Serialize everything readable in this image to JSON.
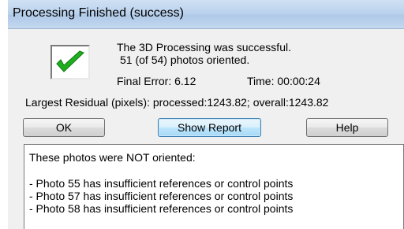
{
  "window": {
    "title": "Processing Finished (success)"
  },
  "summary": {
    "status_line": "The 3D Processing was successful.",
    "oriented_line": "51 (of 54) photos oriented.",
    "final_error": "Final Error:  6.12",
    "time": "Time: 00:00:24",
    "residual": "Largest Residual (pixels): processed:1243.82; overall:1243.82"
  },
  "icons": {
    "success": "checkmark-icon"
  },
  "buttons": {
    "ok": "OK",
    "show_report": "Show Report",
    "help": "Help"
  },
  "report": {
    "heading": "These photos were NOT oriented:",
    "items": [
      "- Photo 55 has insufficient references or control points",
      "- Photo 57 has insufficient references or control points",
      "- Photo 58 has insufficient references or control points"
    ]
  },
  "colors": {
    "check_green": "#1fae1f",
    "title_bar": "#bcd3ee"
  }
}
